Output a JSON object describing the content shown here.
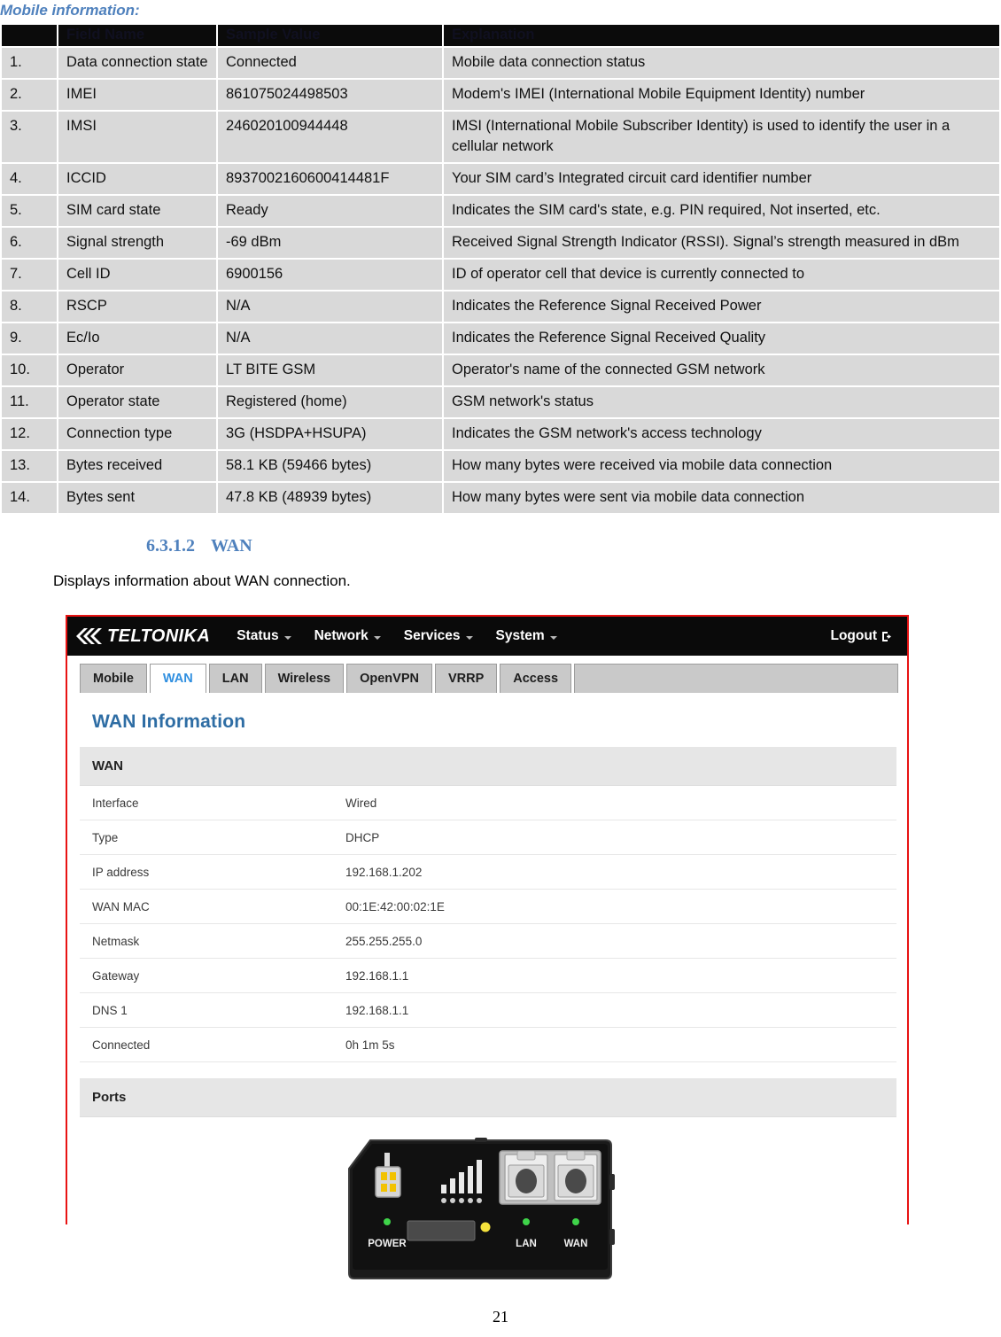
{
  "document": {
    "heading": "Mobile information:",
    "page_number": "21",
    "section": {
      "number": "6.3.1.2",
      "title": "WAN"
    },
    "intro_text": "Displays information about WAN connection."
  },
  "mobile_table": {
    "columns": [
      "",
      "Field Name",
      "Sample  Value",
      "Explanation"
    ],
    "rows": [
      {
        "idx": "1.",
        "field": "Data connection state",
        "value": "Connected",
        "explanation": "Mobile data connection status"
      },
      {
        "idx": "2.",
        "field": "IMEI",
        "value": "861075024498503",
        "explanation": "Modem's IMEI (International Mobile Equipment Identity) number"
      },
      {
        "idx": "3.",
        "field": "IMSI",
        "value": "246020100944448",
        "explanation": "IMSI (International Mobile Subscriber Identity) is used to identify the user in a cellular network"
      },
      {
        "idx": "4.",
        "field": "ICCID",
        "value": "8937002160600414481F",
        "explanation": "Your SIM card’s Integrated circuit card identifier number"
      },
      {
        "idx": "5.",
        "field": "SIM card state",
        "value": "Ready",
        "explanation": "Indicates the SIM card's state, e.g. PIN required, Not inserted, etc."
      },
      {
        "idx": "6.",
        "field": "Signal strength",
        "value": "-69 dBm",
        "explanation": "Received Signal Strength Indicator (RSSI). Signal’s strength measured in dBm"
      },
      {
        "idx": "7.",
        "field": "Cell ID",
        "value": "6900156",
        "explanation": "ID of operator cell that device is currently connected to"
      },
      {
        "idx": "8.",
        "field": "RSCP",
        "value": "N/A",
        "explanation": "Indicates the Reference Signal Received Power"
      },
      {
        "idx": "9.",
        "field": "Ec/Io",
        "value": "N/A",
        "explanation": "Indicates the Reference Signal Received Quality"
      },
      {
        "idx": "10.",
        "field": "Operator",
        "value": "LT BITE GSM",
        "explanation": "Operator's name of the connected GSM network"
      },
      {
        "idx": "11.",
        "field": "Operator state",
        "value": "Registered (home)",
        "explanation": "GSM network's status"
      },
      {
        "idx": "12.",
        "field": "Connection type",
        "value": "3G (HSDPA+HSUPA)",
        "explanation": "Indicates the GSM network's access technology"
      },
      {
        "idx": "13.",
        "field": "Bytes received",
        "value": "58.1 KB (59466 bytes)",
        "explanation": "How many bytes were received via mobile data connection"
      },
      {
        "idx": "14.",
        "field": "Bytes sent",
        "value": "47.8 KB (48939 bytes)",
        "explanation": "How many bytes were sent via mobile data connection"
      }
    ]
  },
  "screenshot": {
    "brand": "TELTONIKA",
    "top_menu": [
      {
        "label": "Status"
      },
      {
        "label": "Network"
      },
      {
        "label": "Services"
      },
      {
        "label": "System"
      }
    ],
    "logout_label": "Logout",
    "tabs": [
      {
        "label": "Mobile",
        "active": false
      },
      {
        "label": "WAN",
        "active": true
      },
      {
        "label": "LAN",
        "active": false
      },
      {
        "label": "Wireless",
        "active": false
      },
      {
        "label": "OpenVPN",
        "active": false
      },
      {
        "label": "VRRP",
        "active": false
      },
      {
        "label": "Access",
        "active": false
      }
    ],
    "panel_title": "WAN Information",
    "wan_group_title": "WAN",
    "wan_rows": [
      {
        "key": "Interface",
        "value": "Wired"
      },
      {
        "key": "Type",
        "value": "DHCP"
      },
      {
        "key": "IP address",
        "value": "192.168.1.202"
      },
      {
        "key": "WAN MAC",
        "value": "00:1E:42:00:02:1E"
      },
      {
        "key": "Netmask",
        "value": "255.255.255.0"
      },
      {
        "key": "Gateway",
        "value": "192.168.1.1"
      },
      {
        "key": "DNS 1",
        "value": "192.168.1.1"
      },
      {
        "key": "Connected",
        "value": "0h 1m 5s"
      }
    ],
    "ports_group_title": "Ports",
    "device_labels": {
      "power": "POWER",
      "lan": "LAN",
      "wan": "WAN"
    }
  },
  "colors": {
    "accent_blue": "#4f81bd",
    "panel_blue": "#2e6da4",
    "tab_active_blue": "#2f8fe0",
    "frame_red": "#e81313",
    "table_row_grey": "#d9d9d9",
    "header_black": "#0b0b0b"
  }
}
